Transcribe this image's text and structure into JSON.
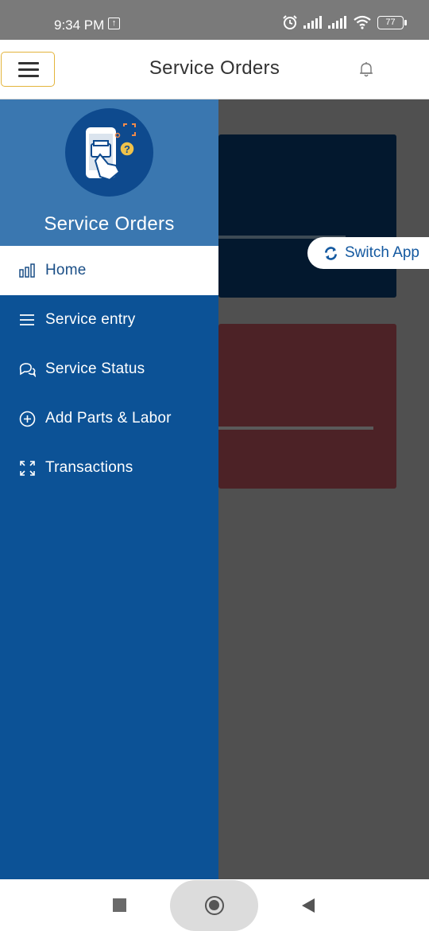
{
  "status_bar": {
    "time": "9:34 PM",
    "upload_glyph": "↑",
    "battery": "77",
    "icons": [
      "alarm-icon",
      "signal-icon",
      "signal-icon",
      "wifi-icon",
      "battery-icon"
    ]
  },
  "app_bar": {
    "title": "Service Orders",
    "menu_icon": "hamburger-icon",
    "notification_icon": "bell-icon"
  },
  "drawer": {
    "title": "Service Orders",
    "logo_icon": "service-orders-logo",
    "items": [
      {
        "label": "Home",
        "icon": "bar-chart-icon",
        "active": true
      },
      {
        "label": "Service entry",
        "icon": "list-icon",
        "active": false
      },
      {
        "label": "Service Status",
        "icon": "chat-bubbles-icon",
        "active": false
      },
      {
        "label": "Add Parts & Labor",
        "icon": "plus-circle-icon",
        "active": false
      },
      {
        "label": "Transactions",
        "icon": "expand-arrows-icon",
        "active": false
      }
    ]
  },
  "switch_app": {
    "label": "Switch App",
    "icon": "refresh-icon"
  },
  "colors": {
    "drawer_bg": "#0c5296",
    "drawer_header_bg": "#3a77b0",
    "accent_border": "#e3b43b",
    "active_text": "#1a4e86",
    "switch_text": "#1459a0"
  }
}
